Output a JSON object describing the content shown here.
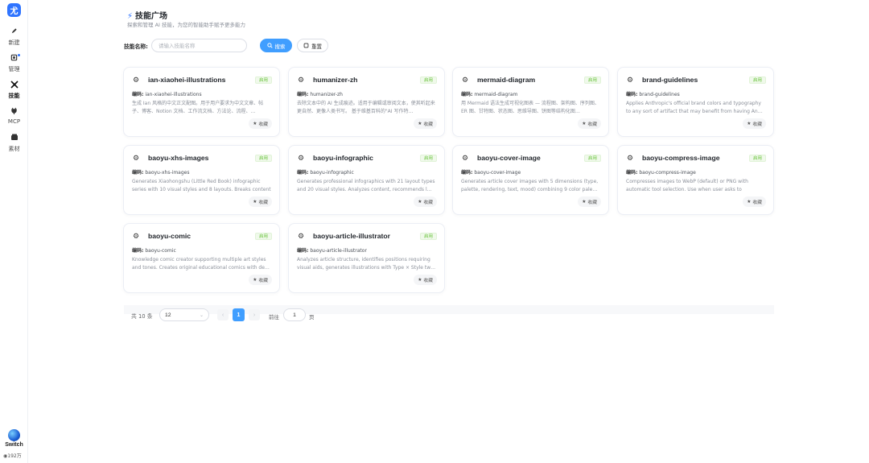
{
  "sidebar": {
    "logo_text": "尤",
    "items": [
      {
        "label": "新建",
        "icon": "pen-icon"
      },
      {
        "label": "管理",
        "icon": "manage-icon"
      },
      {
        "label": "技能",
        "icon": "skill-icon"
      },
      {
        "label": "MCP",
        "icon": "plug-icon"
      },
      {
        "label": "素材",
        "icon": "material-icon"
      }
    ],
    "user_label": "Switch",
    "credit": "192万"
  },
  "header": {
    "title": "技能广场",
    "subtitle": "探索和管理 AI 技能，为您的智能助手赋予更多能力"
  },
  "search": {
    "label": "技能名称:",
    "placeholder": "请输入技能名称",
    "value": "",
    "search_button": "搜索",
    "reset_button": "重置"
  },
  "cards": [
    {
      "name": "ian-xiaohei-illustrations",
      "status": "启用",
      "code_label": "编码:",
      "code": "ian-xiaohei-illustrations",
      "desc": "生成 Ian 风格的中文正文配图。用于用户要求为中文文章、帖子、博客、Notion 文档、工作流文档、方法论、流程、…",
      "fav": "收藏"
    },
    {
      "name": "humanizer-zh",
      "status": "启用",
      "code_label": "编码:",
      "code": "humanizer-zh",
      "desc": "去除文本中的 AI 生成痕迹。适用于编辑或审阅文本，使其听起来更自然、更像人类书写。 基于维基百科的\"AI 写作特…",
      "fav": "收藏"
    },
    {
      "name": "mermaid-diagram",
      "status": "启用",
      "code_label": "编码:",
      "code": "mermaid-diagram",
      "desc": "用 Mermaid 语法生成可视化图表 — 流程图、架构图、序列图、ER 图、甘特图、状态图、思维导图、饼图等结构化图…",
      "fav": "收藏"
    },
    {
      "name": "brand-guidelines",
      "status": "启用",
      "code_label": "编码:",
      "code": "brand-guidelines",
      "desc": "Applies Anthropic's official brand colors and typography to any sort of artifact that may benefit from having An…",
      "fav": "收藏"
    },
    {
      "name": "baoyu-xhs-images",
      "status": "启用",
      "code_label": "编码:",
      "code": "baoyu-xhs-images",
      "desc": "Generates Xiaohongshu (Little Red Book) infographic series with 10 visual styles and 8 layouts. Breaks content …",
      "fav": "收藏"
    },
    {
      "name": "baoyu-infographic",
      "status": "启用",
      "code_label": "编码:",
      "code": "baoyu-infographic",
      "desc": "Generates professional infographics with 21 layout types and 20 visual styles. Analyzes content, recommends l…",
      "fav": "收藏"
    },
    {
      "name": "baoyu-cover-image",
      "status": "启用",
      "code_label": "编码:",
      "code": "baoyu-cover-image",
      "desc": "Generates article cover images with 5 dimensions (type, palette, rendering, text, mood) combining 9 color pale…",
      "fav": "收藏"
    },
    {
      "name": "baoyu-compress-image",
      "status": "启用",
      "code_label": "编码:",
      "code": "baoyu-compress-image",
      "desc": "Compresses images to WebP (default) or PNG with automatic tool selection. Use when user asks to \"compress …",
      "fav": "收藏"
    },
    {
      "name": "baoyu-comic",
      "status": "启用",
      "code_label": "编码:",
      "code": "baoyu-comic",
      "desc": "Knowledge comic creator supporting multiple art styles and tones. Creates original educational comics with de…",
      "fav": "收藏"
    },
    {
      "name": "baoyu-article-illustrator",
      "status": "启用",
      "code_label": "编码:",
      "code": "baoyu-article-illustrator",
      "desc": "Analyzes article structure, identifies positions requiring visual aids, generates illustrations with Type × Style tw…",
      "fav": "收藏"
    }
  ],
  "pagination": {
    "total": "共 10 条",
    "page_size": "12",
    "current_page": "1",
    "goto_label": "前往",
    "goto_value": "1",
    "page_suffix": "页"
  },
  "colors": {
    "accent": "#409eff",
    "status_green": "#67c23a"
  }
}
